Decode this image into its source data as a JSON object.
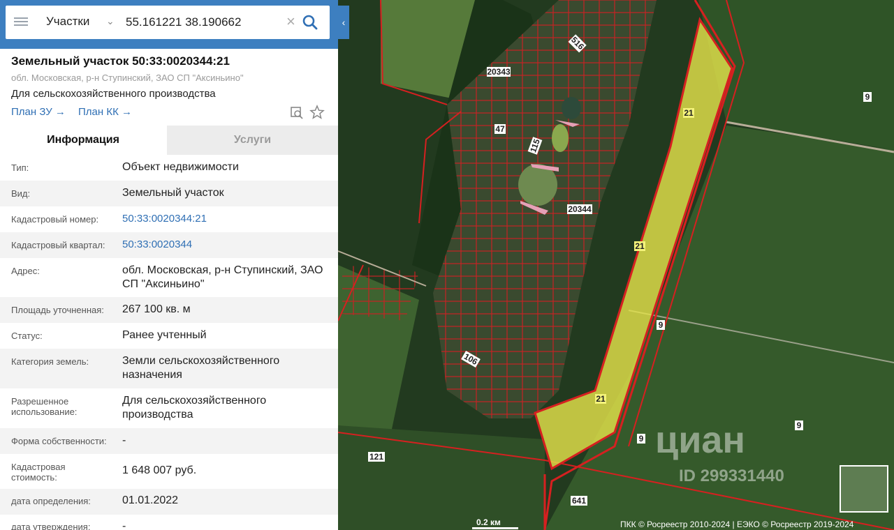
{
  "search": {
    "layer": "Участки",
    "query": "55.161221 38.190662"
  },
  "parcel": {
    "title": "Земельный участок 50:33:0020344:21",
    "subaddress": "обл. Московская, р-н Ступинский, ЗАО СП \"Аксиньино\"",
    "purpose": "Для сельскохозяйственного производства",
    "links": [
      "План ЗУ →",
      "План КК →"
    ]
  },
  "tabs": [
    "Информация",
    "Услуги"
  ],
  "rows": [
    {
      "label": "Тип:",
      "value": "Объект недвижимости"
    },
    {
      "label": "Вид:",
      "value": "Земельный участок"
    },
    {
      "label": "Кадастровый номер:",
      "value": "50:33:0020344:21"
    },
    {
      "label": "Кадастровый квартал:",
      "value": "50:33:0020344"
    },
    {
      "label": "Адрес:",
      "value": "обл. Московская, р-н Ступинский, ЗАО СП \"Аксиньино\""
    },
    {
      "label": "Площадь уточненная:",
      "value": "267 100 кв. м"
    },
    {
      "label": "Статус:",
      "value": "Ранее учтенный"
    },
    {
      "label": "Категория земель:",
      "value": "Земли сельскохозяйственного назначения"
    },
    {
      "label": "Разрешенное использование:",
      "value": "Для сельскохозяйственного производства"
    },
    {
      "label": "Форма собственности:",
      "value": "-"
    },
    {
      "label": "Кадастровая стоимость:",
      "value": "1 648 007 руб."
    },
    {
      "label": "дата определения:",
      "value": "01.01.2022"
    },
    {
      "label": "дата утверждения:",
      "value": "-"
    }
  ],
  "map": {
    "labels": [
      "516",
      "20343",
      "47",
      "115",
      "20344",
      "106",
      "121",
      "641",
      "21",
      "21",
      "21",
      "9",
      "9",
      "9",
      "9"
    ],
    "scale": "0.2 км",
    "attribution": "ПКК © Росреестр 2010-2024 | ЕЭКО © Росреестр 2019-2024",
    "watermark": "циан",
    "watermark_id": "ID 299331440"
  },
  "colors": {
    "header": "#3d7fc0",
    "link": "#2f6fb4",
    "parcel_fill": "#e3e24a",
    "boundary": "#d62020"
  }
}
